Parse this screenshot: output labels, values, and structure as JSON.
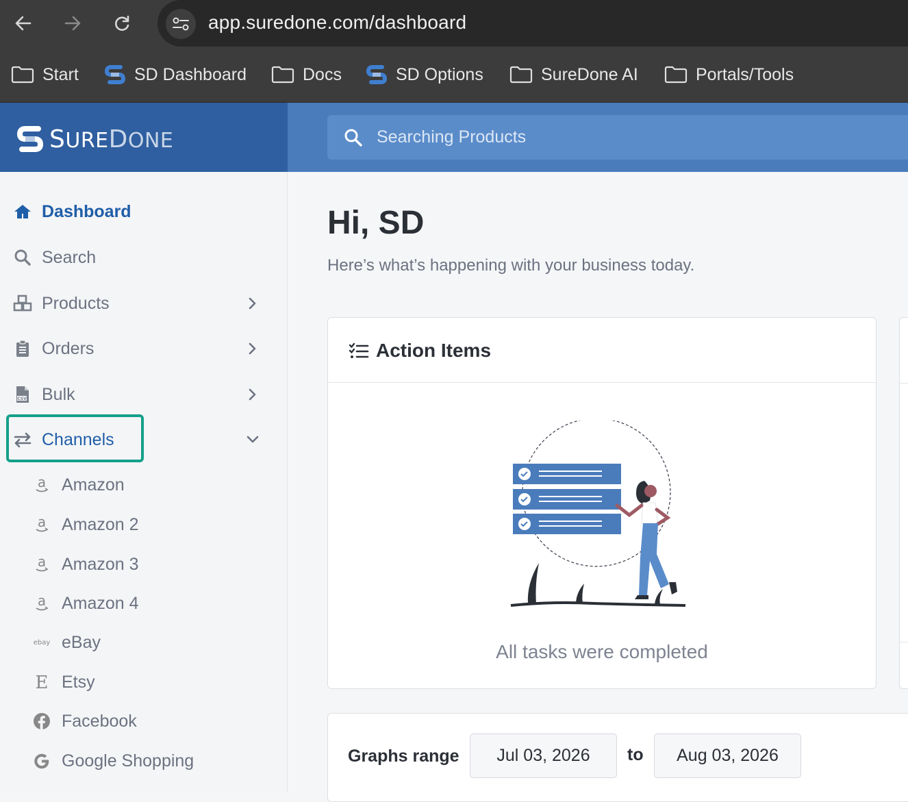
{
  "browser": {
    "url": "app.suredone.com/dashboard",
    "bookmarks": [
      {
        "label": "Start",
        "icon": "folder-icon"
      },
      {
        "label": "SD Dashboard",
        "icon": "suredone-logo-icon"
      },
      {
        "label": "Docs",
        "icon": "folder-icon"
      },
      {
        "label": "SD Options",
        "icon": "suredone-logo-icon"
      },
      {
        "label": "SureDone AI",
        "icon": "folder-icon"
      },
      {
        "label": "Portals/Tools",
        "icon": "folder-icon"
      }
    ]
  },
  "header": {
    "logo": {
      "sure": "SURE",
      "done": "DONE",
      "s_initial": "S",
      "d_initial": "D",
      "sure_rest": "URE",
      "done_rest": "ONE"
    },
    "search_placeholder": "Searching Products"
  },
  "sidebar": {
    "items": [
      {
        "label": "Dashboard",
        "icon": "home-icon",
        "active": true
      },
      {
        "label": "Search",
        "icon": "search-icon"
      },
      {
        "label": "Products",
        "icon": "boxes-icon"
      },
      {
        "label": "Orders",
        "icon": "clipboard-icon"
      },
      {
        "label": "Bulk",
        "icon": "csv-file-icon"
      },
      {
        "label": "Channels",
        "icon": "arrows-exchange-icon"
      }
    ],
    "channels": [
      {
        "label": "Amazon",
        "icon": "amazon-icon"
      },
      {
        "label": "Amazon 2",
        "icon": "amazon-icon"
      },
      {
        "label": "Amazon 3",
        "icon": "amazon-icon"
      },
      {
        "label": "Amazon 4",
        "icon": "amazon-icon"
      },
      {
        "label": "eBay",
        "icon": "ebay-icon"
      },
      {
        "label": "Etsy",
        "icon": "etsy-icon"
      },
      {
        "label": "Facebook",
        "icon": "facebook-icon"
      },
      {
        "label": "Google Shopping",
        "icon": "google-icon"
      }
    ]
  },
  "main": {
    "greeting": "Hi, SD",
    "subtitle": "Here’s what’s happening with your business today.",
    "action_items": {
      "title": "Action Items",
      "empty_text": "All tasks were completed"
    },
    "graphs": {
      "label": "Graphs range",
      "from": "Jul 03, 2026",
      "to_label": "to",
      "to": "Aug 03, 2026"
    }
  },
  "colors": {
    "header_blue": "#4a7cbc",
    "logo_blue": "#2f5fa0",
    "active_blue": "#1f5ea8",
    "highlight_teal": "#14a08a"
  }
}
